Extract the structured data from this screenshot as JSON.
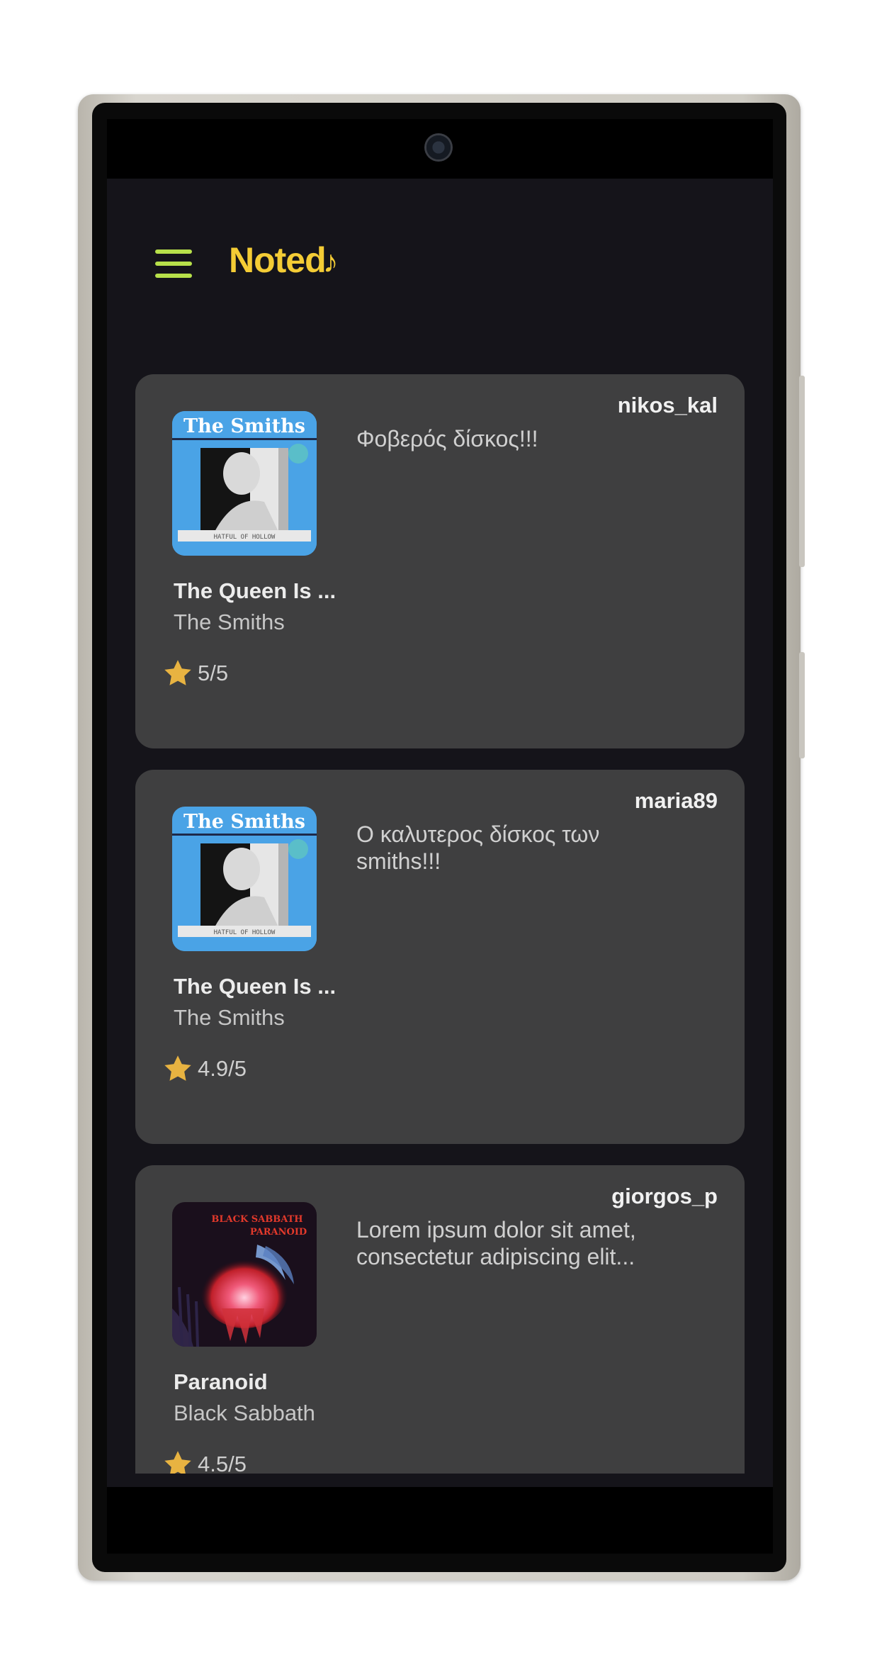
{
  "app": {
    "title": "Noted",
    "title_glyph": "♪",
    "accent_color": "#f4cc35",
    "menu_icon_color": "#b7e04a",
    "background": "#15141a",
    "card_background": "#3f3f40",
    "rating_star_color": "#e8b341"
  },
  "feed": [
    {
      "username": "nikos_kal",
      "comment": "Φοβερός δίσκος!!!",
      "album_title": "The Queen Is ...",
      "artist": "The Smiths",
      "rating": "5/5",
      "cover": {
        "icon": "album-cover-the-smiths",
        "text": "The Smiths",
        "caption": "HATFUL OF HOLLOW"
      }
    },
    {
      "username": "maria89",
      "comment": "Ο καλυτερος δίσκος των smiths!!!",
      "album_title": "The Queen Is ...",
      "artist": "The Smiths",
      "rating": "4.9/5",
      "cover": {
        "icon": "album-cover-the-smiths",
        "text": "The Smiths",
        "caption": "HATFUL OF HOLLOW"
      }
    },
    {
      "username": "giorgos_p",
      "comment": "Lorem ipsum dolor sit amet, consectetur adipiscing elit...",
      "album_title": "Paranoid",
      "artist": "Black Sabbath",
      "rating": "4.5/5",
      "cover": {
        "icon": "album-cover-paranoid",
        "text_line1": "BLACK SABBATH",
        "text_line2": "PARANOID"
      }
    }
  ]
}
